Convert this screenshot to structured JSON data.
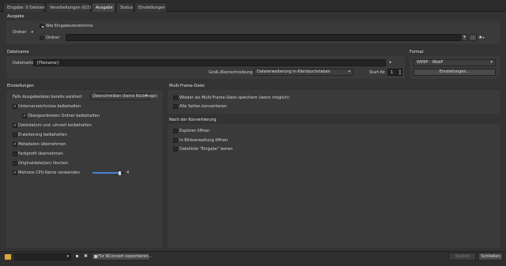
{
  "tabs": [
    "Eingabe: 0 Dateien",
    "Verarbeitungen (0/2)",
    "Ausgabe",
    "Status",
    "Einstellungen"
  ],
  "active_tab": 2,
  "ausgabe": {
    "title": "Ausgabe",
    "mode_select": "Ordner",
    "option_same": "Wie Eingabeverzeichnis",
    "option_folder": "Ordner",
    "folder_value": ""
  },
  "dateiname": {
    "title": "Dateiname",
    "label": "Dateiname",
    "value": "{Filename}",
    "case_label": "Groß-/Kleinschreibung",
    "case_value": "Dateierweiterung in Kleinbuchstaben",
    "start_label": "Start-Nr.",
    "start_value": "1"
  },
  "format": {
    "title": "Format",
    "value": "WEBP - WebP",
    "settings_button": "Einstellungen..."
  },
  "einstellungen": {
    "title": "Einstellungen",
    "exists_label": "Falls Ausgabedatei bereits existiert",
    "exists_value": "Überschreiben (keine Rückfrage)",
    "options": [
      {
        "label": "Unterverzeichnisse beibehalten",
        "checked": true
      },
      {
        "label": "Übergeordneten Ordner beibehalten",
        "checked": true
      },
      {
        "label": "Dateidatum und -uhrzeit beibehalten",
        "checked": true
      },
      {
        "label": "Erweiterung beibehalten",
        "checked": false
      },
      {
        "label": "Metadaten übernehmen",
        "checked": true
      },
      {
        "label": "Farbprofil übernehmen",
        "checked": false
      },
      {
        "label": "Originaldatei(en) löschen",
        "checked": false
      },
      {
        "label": "Mehrere CPU-Kerne verwenden",
        "checked": true
      }
    ],
    "cpu_value": "4",
    "cpu_fraction": 0.85
  },
  "multiframe": {
    "title": "Multi-Frame-Datei",
    "options": [
      {
        "label": "Wieder als Multi-Frame-Datei speichern (wenn möglich)",
        "checked": false
      },
      {
        "label": "Alle Seiten konvertieren",
        "checked": false
      }
    ]
  },
  "nachkonv": {
    "title": "Nach der Konvertierung",
    "options": [
      {
        "label": "Explorer öffnen",
        "checked": false
      },
      {
        "label": "In Bildverwaltung öffnen",
        "checked": false
      },
      {
        "label": "Dateiliste \"Eingabe\" leeren",
        "checked": false
      }
    ]
  },
  "bottom": {
    "preset_value": "",
    "export_label": "Für NConvert exportieren...",
    "start_label": "Starten",
    "close_label": "Schließen"
  },
  "colors": {
    "background": "#333333",
    "panel": "#3a3a3a",
    "slider": "#4a7fd8"
  }
}
